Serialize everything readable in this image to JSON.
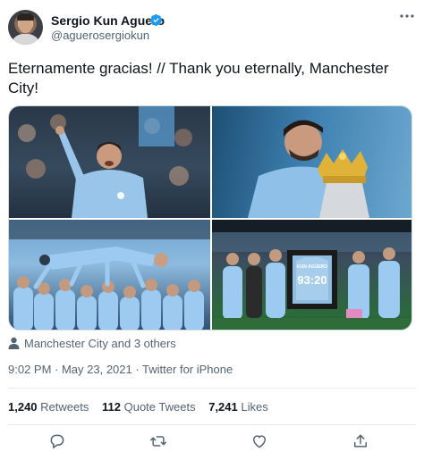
{
  "author": {
    "display_name": "Sergio Kun Aguero",
    "handle": "@aguerosergiokun",
    "verified": true
  },
  "tweet": {
    "text": "Eternamente gracias! // Thank you eternally, Manchester City!"
  },
  "media": {
    "count": 4,
    "photos": [
      {
        "subject": "player celebrating in crowd",
        "jersey_name": ""
      },
      {
        "subject": "player with trophy",
        "jersey_name": ""
      },
      {
        "subject": "teammates tossing player in air",
        "jersey_name": ""
      },
      {
        "subject": "team presenting framed shirt",
        "jersey_name": "KUN AGÜERO",
        "jersey_number": "93:20"
      }
    ]
  },
  "tags": {
    "text": "Manchester City and 3 others"
  },
  "meta": {
    "timestamp": "9:02 PM · May 23, 2021 · Twitter for iPhone"
  },
  "stats": {
    "retweets_count": "1,240",
    "retweets_label": "Retweets",
    "quotes_count": "112",
    "quotes_label": "Quote Tweets",
    "likes_count": "7,241",
    "likes_label": "Likes"
  },
  "colors": {
    "text_primary": "#0f1419",
    "text_secondary": "#536471",
    "verified": "#1d9bf0",
    "divider": "#e5eaec"
  },
  "icons": [
    "verified-badge-icon",
    "more-icon",
    "person-icon",
    "reply-icon",
    "retweet-icon",
    "like-icon",
    "share-icon"
  ]
}
